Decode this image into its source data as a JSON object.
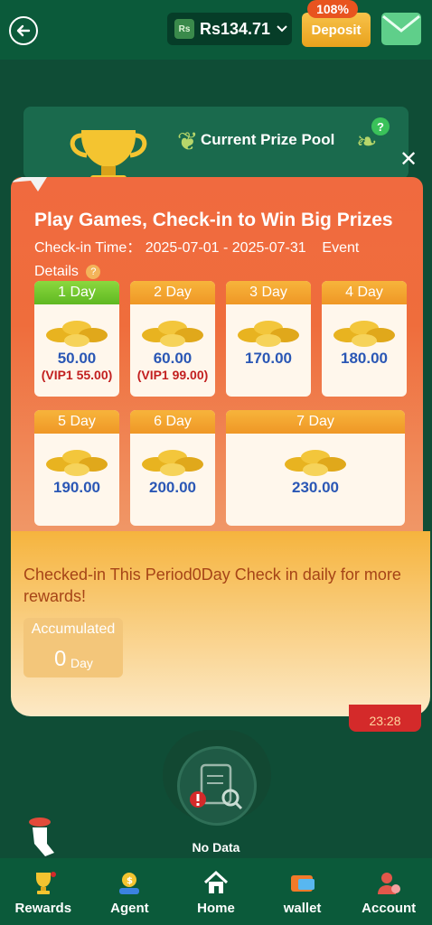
{
  "header": {
    "currency_badge": "Rs",
    "balance": "Rs134.71",
    "deposit_label": "Deposit",
    "deposit_badge": "108%"
  },
  "prize_pool": {
    "title": "Current Prize Pool"
  },
  "modal": {
    "title": "Play Games, Check-in to Win Big Prizes",
    "checkin_label": "Check-in Time：",
    "checkin_range": "2025-07-01 - 2025-07-31",
    "event_details": "Event Details",
    "days": [
      {
        "label": "1 Day",
        "amount": "50.00",
        "vip": "(VIP1 55.00)"
      },
      {
        "label": "2 Day",
        "amount": "60.00",
        "vip": "(VIP1 99.00)"
      },
      {
        "label": "3 Day",
        "amount": "170.00",
        "vip": ""
      },
      {
        "label": "4 Day",
        "amount": "180.00",
        "vip": ""
      },
      {
        "label": "5 Day",
        "amount": "190.00",
        "vip": ""
      },
      {
        "label": "6 Day",
        "amount": "200.00",
        "vip": ""
      },
      {
        "label": "7 Day",
        "amount": "230.00",
        "vip": ""
      }
    ],
    "period_text": "Checked-in This Period0Day Check in daily for more rewards!",
    "accumulated_label": "Accumulated",
    "accumulated_value": "0",
    "accumulated_unit": "Day"
  },
  "side_badge": "23:28",
  "empty_state": {
    "text": "No Data"
  },
  "nav": {
    "rewards": "Rewards",
    "agent": "Agent",
    "home": "Home",
    "wallet": "wallet",
    "account": "Account"
  },
  "colors": {
    "brand_green": "#0b5a3a",
    "modal_orange": "#ef6d3c",
    "deposit_gold": "#f7c24a"
  }
}
